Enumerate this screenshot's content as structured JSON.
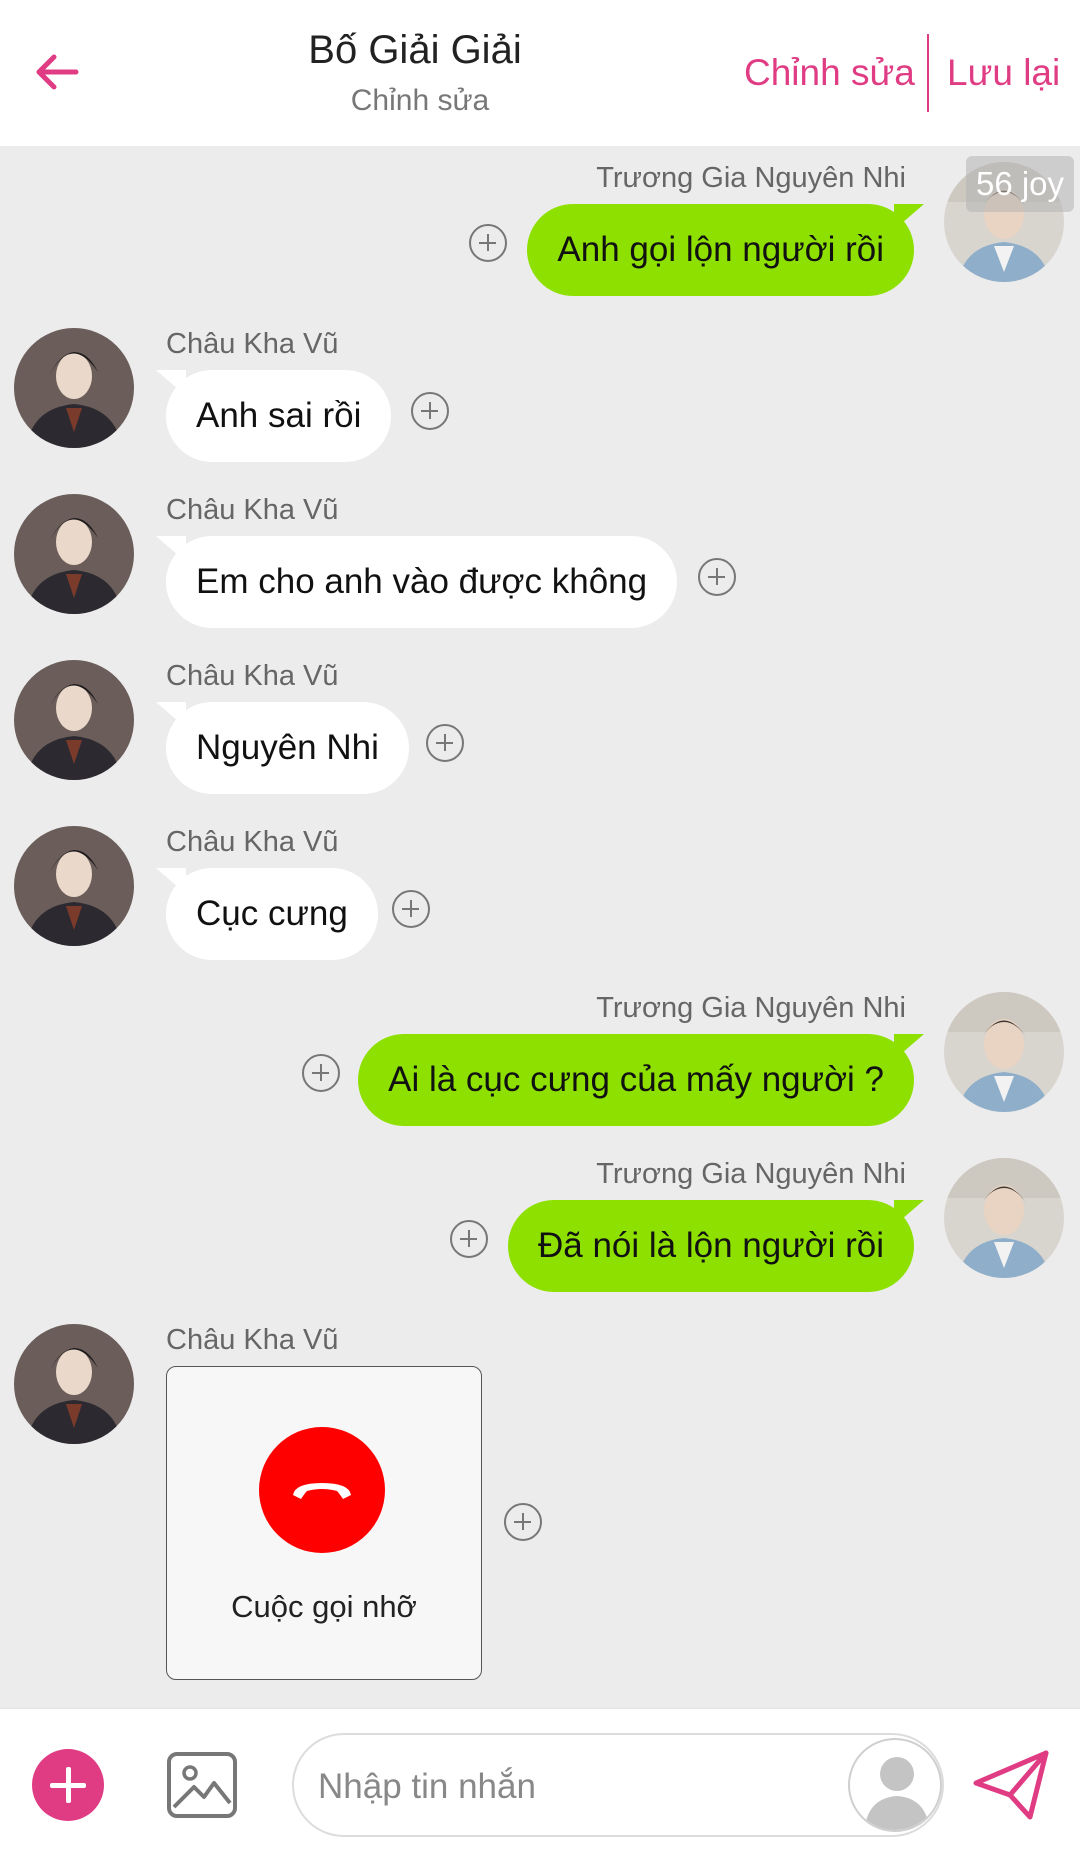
{
  "header": {
    "title": "Bố Giải Giải",
    "subtitle": "Chỉnh sửa",
    "edit_label": "Chỉnh sửa",
    "save_label": "Lưu lại",
    "accent_color": "#e03c84"
  },
  "badge": {
    "text": "56 joy"
  },
  "messages": [
    {
      "sender": "Trương Gia Nguyên Nhi",
      "text": "Anh gọi lộn người rồi",
      "direction": "outgoing"
    },
    {
      "sender": "Châu Kha Vũ",
      "text": "Anh sai rồi",
      "direction": "incoming"
    },
    {
      "sender": "Châu Kha Vũ",
      "text": "Em cho anh vào được không",
      "direction": "incoming"
    },
    {
      "sender": "Châu Kha Vũ",
      "text": "Nguyên Nhi",
      "direction": "incoming"
    },
    {
      "sender": "Châu Kha Vũ",
      "text": "Cục cưng",
      "direction": "incoming"
    },
    {
      "sender": "Trương Gia Nguyên Nhi",
      "text": "Ai là cục cưng của mấy người ?",
      "direction": "outgoing"
    },
    {
      "sender": "Trương Gia Nguyên Nhi",
      "text": "Đã nói là lộn người rồi",
      "direction": "outgoing"
    },
    {
      "sender": "Châu Kha Vũ",
      "call_label": "Cuộc gọi nhỡ",
      "direction": "incoming",
      "type": "missed-call"
    }
  ],
  "composer": {
    "placeholder": "Nhập tin nhắn"
  },
  "colors": {
    "outgoing_bubble": "#8ee000",
    "incoming_bubble": "#ffffff",
    "missed_call": "#ff0000",
    "chat_background": "#ececec"
  }
}
